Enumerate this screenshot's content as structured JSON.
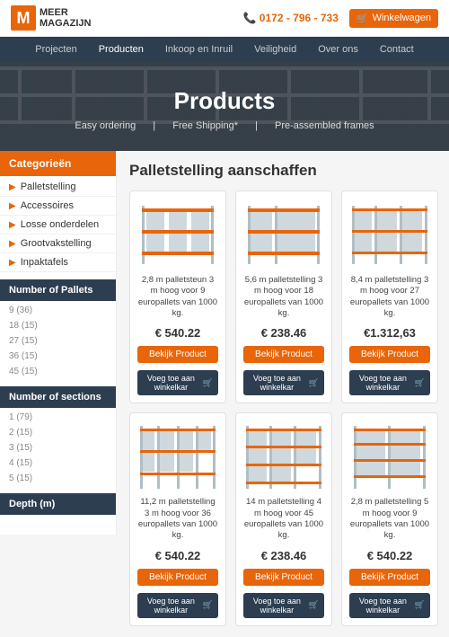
{
  "topbar": {
    "logo_letter": "M",
    "logo_line1": "MEER",
    "logo_line2": "MAGAZIJN",
    "phone": "0172 - 796 - 733",
    "cart_label": "Winkelwagen"
  },
  "nav": {
    "items": [
      {
        "label": "Projecten",
        "active": false
      },
      {
        "label": "Producten",
        "active": true
      },
      {
        "label": "Inkoop en Inruil",
        "active": false
      },
      {
        "label": "Veiligheid",
        "active": false
      },
      {
        "label": "Over ons",
        "active": false
      },
      {
        "label": "Contact",
        "active": false
      }
    ]
  },
  "hero": {
    "title": "Products",
    "sub1": "Easy ordering",
    "sub2": "Free Shipping*",
    "sub3": "Pre-assembled frames"
  },
  "sidebar": {
    "categories_title": "Categorieën",
    "categories": [
      {
        "label": "Palletstelling"
      },
      {
        "label": "Accessoires"
      },
      {
        "label": "Losse onderdelen"
      },
      {
        "label": "Grootvakstelling"
      },
      {
        "label": "Inpaktafels"
      }
    ],
    "pallets_title": "Number of Pallets",
    "pallets": [
      {
        "label": "9 (36)"
      },
      {
        "label": "18 (15)"
      },
      {
        "label": "27 (15)"
      },
      {
        "label": "36 (15)"
      },
      {
        "label": "45 (15)"
      }
    ],
    "sections_title": "Number of sections",
    "sections": [
      {
        "label": "1 (79)"
      },
      {
        "label": "2 (15)"
      },
      {
        "label": "3 (15)"
      },
      {
        "label": "4 (15)"
      },
      {
        "label": "5 (15)"
      }
    ],
    "depth_title": "Depth (m)"
  },
  "content": {
    "title": "Palletstelling aanschaffen",
    "products": [
      {
        "desc": "2,8 m palletsteun 3 m hoog voor 9 europallets van 1000 kg.",
        "price": "€ 540.22",
        "view_label": "Bekijk Product",
        "cart_label": "Voeg toe aan winkelkar"
      },
      {
        "desc": "5,6 m palletstelling 3 m hoog voor 18 europallets van 1000 kg.",
        "price": "€ 238.46",
        "view_label": "Bekijk Product",
        "cart_label": "Voeg toe aan winkelkar"
      },
      {
        "desc": "8,4 m palletstelling 3 m hoog voor 27 europallets van 1000 kg.",
        "price": "€1.312,63",
        "view_label": "Bekijk Product",
        "cart_label": "Voeg toe aan winkelkar"
      },
      {
        "desc": "11,2 m palletstelling 3 m hoog voor 36 europallets van 1000 kg.",
        "price": "€ 540.22",
        "view_label": "Bekijk Product",
        "cart_label": "Voeg toe aan winkelkar"
      },
      {
        "desc": "14 m palletstelling 4 m hoog voor 45 europallets van 1000 kg.",
        "price": "€ 238.46",
        "view_label": "Bekijk Product",
        "cart_label": "Voeg toe aan winkelkar"
      },
      {
        "desc": "2,8 m palletstelling 5 m hoog voor 9 europallets van 1000 kg.",
        "price": "€ 540.22",
        "view_label": "Bekijk Product",
        "cart_label": "Voeg toe aan winkelkar"
      }
    ]
  }
}
